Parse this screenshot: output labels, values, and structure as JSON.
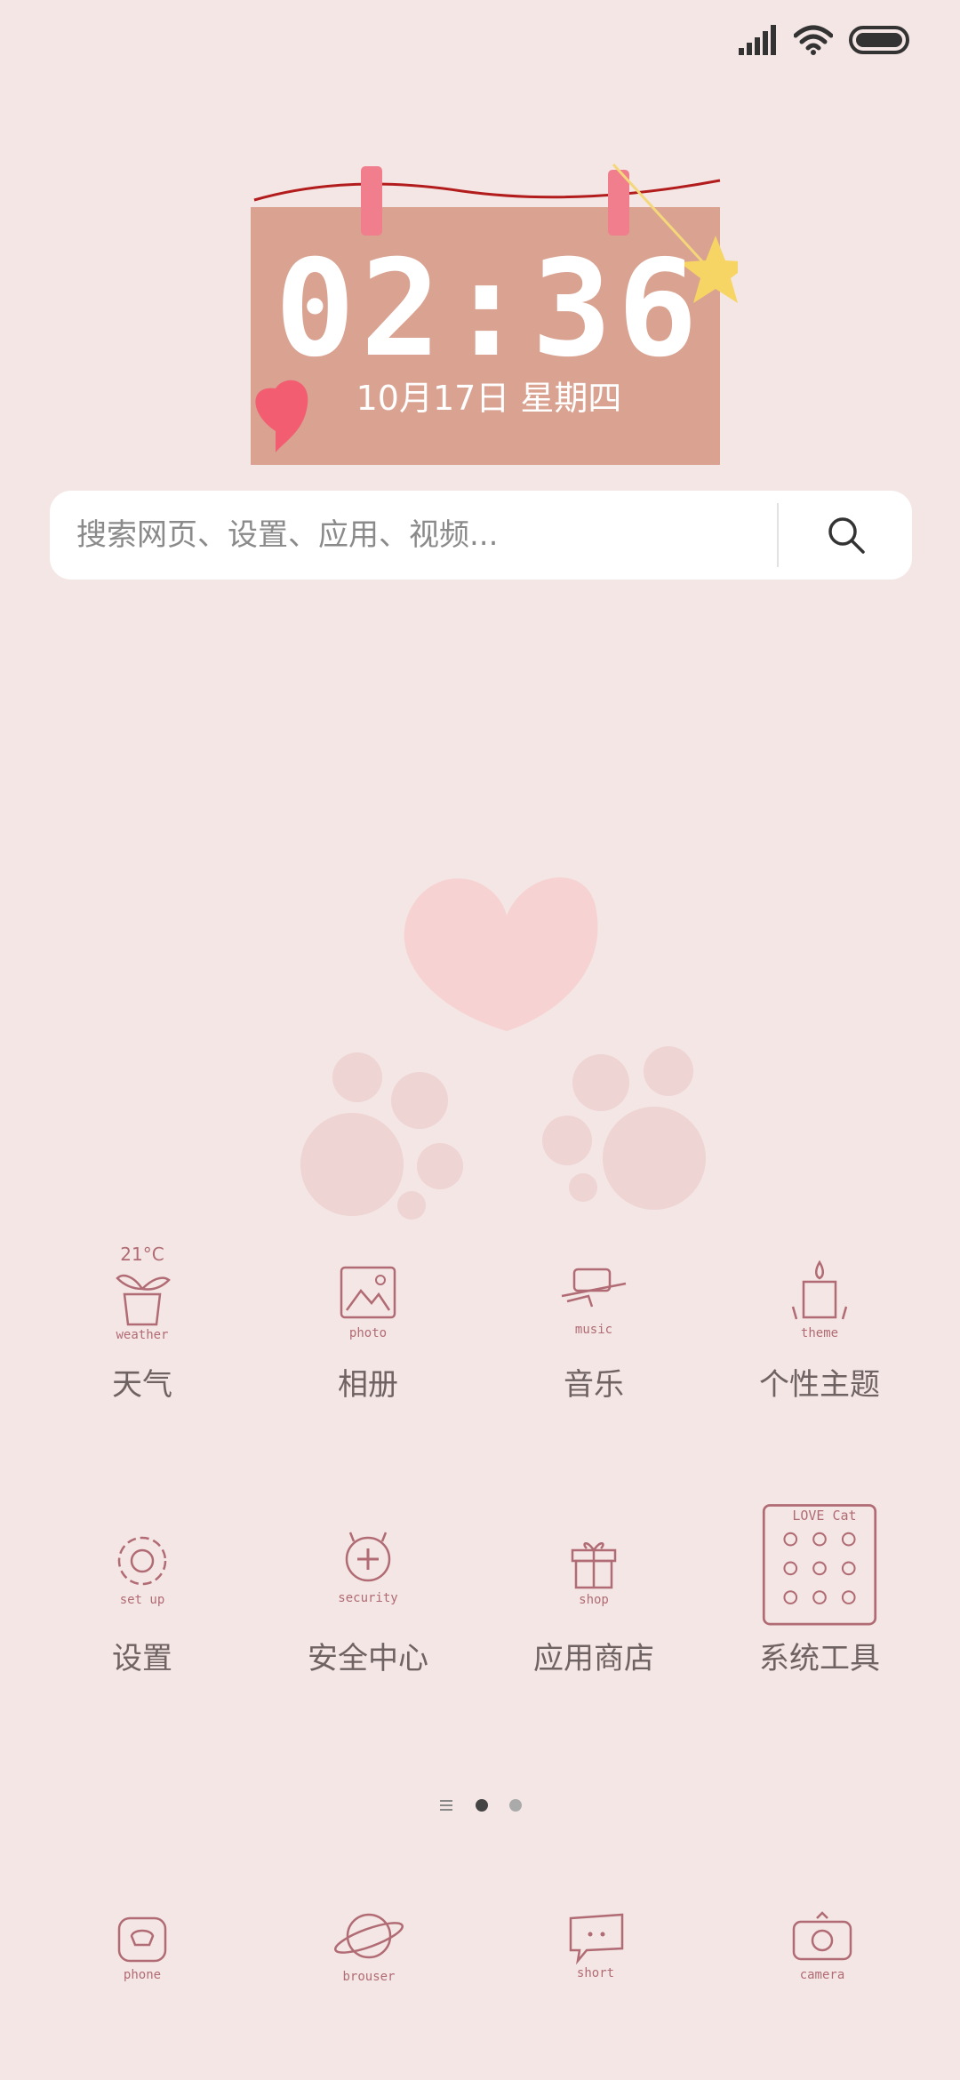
{
  "status_bar": {
    "icons": [
      "signal-icon",
      "wifi-icon",
      "battery-icon"
    ]
  },
  "clock_widget": {
    "time": "02:36",
    "date": "10月17日 星期四"
  },
  "search": {
    "placeholder": "搜索网页、设置、应用、视频..."
  },
  "apps": [
    {
      "label": "天气",
      "icon_caption": "weather",
      "temperature": "21°C"
    },
    {
      "label": "相册",
      "icon_caption": "photo"
    },
    {
      "label": "音乐",
      "icon_caption": "music"
    },
    {
      "label": "个性主题",
      "icon_caption": "theme"
    },
    {
      "label": "设置",
      "icon_caption": "set up"
    },
    {
      "label": "安全中心",
      "icon_caption": "security"
    },
    {
      "label": "应用商店",
      "icon_caption": "shop"
    },
    {
      "label": "系统工具",
      "icon_caption": "LOVE Cat"
    }
  ],
  "page_indicator": {
    "current_page": 1,
    "pages": 2
  },
  "dock": [
    {
      "icon_caption": "phone"
    },
    {
      "icon_caption": "brouser"
    },
    {
      "icon_caption": "short"
    },
    {
      "icon_caption": "camera"
    }
  ],
  "colors": {
    "background": "#f4e6e4",
    "widget_note": "#d9a291",
    "icon_stroke": "#b06b74",
    "label_text": "#6f6262"
  }
}
